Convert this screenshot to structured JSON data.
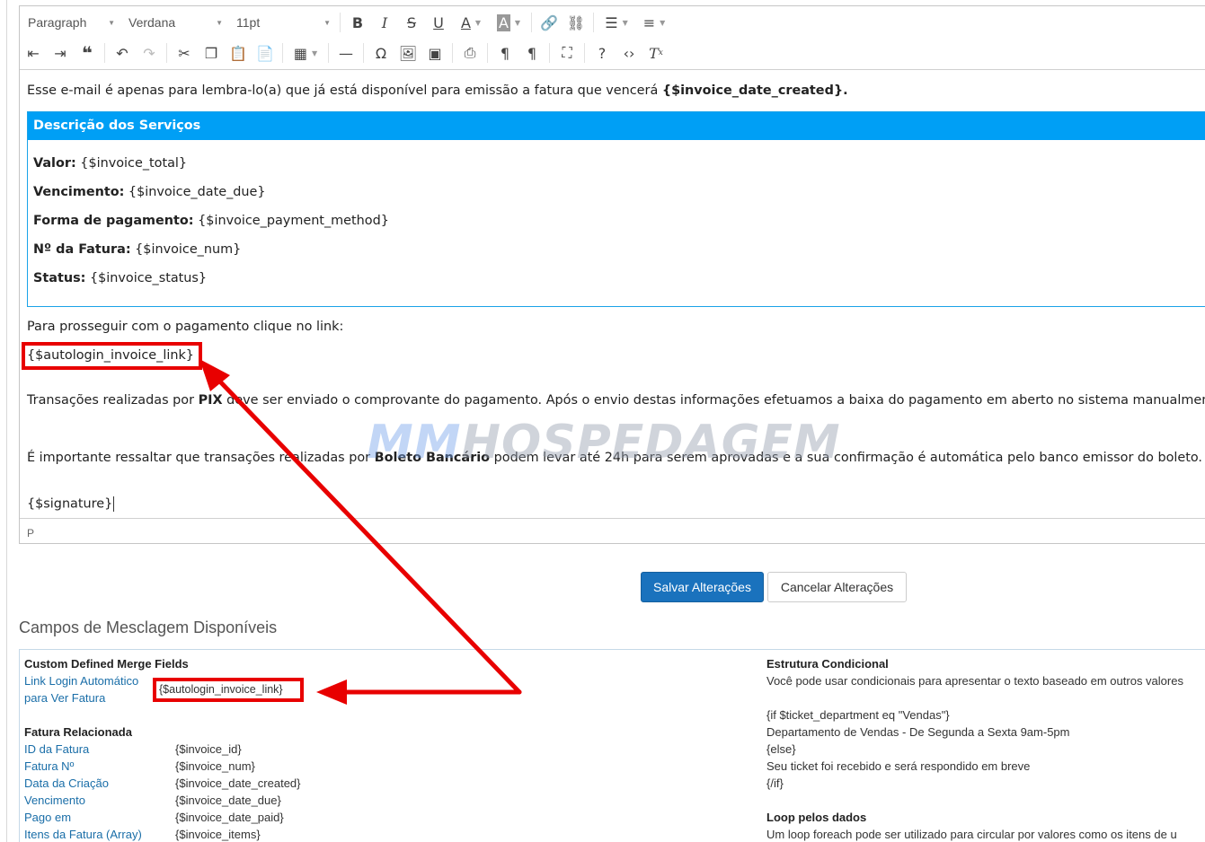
{
  "toolbar": {
    "format": "Paragraph",
    "font": "Verdana",
    "size": "11pt",
    "row1_icons": [
      "bold-icon",
      "italic-icon",
      "strikethrough-icon",
      "underline-icon",
      "font-color-icon",
      "background-color-icon",
      "link-icon",
      "unlink-icon",
      "bullet-list-icon",
      "numbered-list-icon"
    ],
    "row2_icons": [
      "outdent-icon",
      "indent-icon",
      "blockquote-icon",
      "undo-icon",
      "redo-icon",
      "cut-icon",
      "copy-icon",
      "paste-icon",
      "paste-text-icon",
      "table-icon",
      "horizontal-rule-icon",
      "special-char-icon",
      "image-icon",
      "media-icon",
      "print-icon",
      "ltr-icon",
      "rtl-icon",
      "fullscreen-icon",
      "help-icon",
      "source-code-icon",
      "clear-format-icon"
    ]
  },
  "content": {
    "intro_text": "Esse e-mail é apenas para lembra-lo(a) que já está disponível para emissão a fatura que vencerá ",
    "intro_var": "{$invoice_date_created}.",
    "services": {
      "heading": "Descrição dos Serviços",
      "lines": [
        {
          "label": "Valor:",
          "value": " {$invoice_total}"
        },
        {
          "label": "Vencimento:",
          "value": " {$invoice_date_due}"
        },
        {
          "label": "Forma de pagamento:",
          "value": " {$invoice_payment_method}"
        },
        {
          "label": "Nº da Fatura:",
          "value": " {$invoice_num}"
        },
        {
          "label": "Status:",
          "value": " {$invoice_status}"
        }
      ]
    },
    "payment_text": "Para prosseguir com o pagamento clique no link:",
    "autologin_var": "{$autologin_invoice_link}",
    "pix_text_1": "Transações realizadas por ",
    "pix_bold": "PIX",
    "pix_text_2": " deve ser enviado o comprovante do pagamento. Após o envio destas informações efetuamos a baixa do pagamento em aberto no sistema manualmente.",
    "boleto_text_1": "É importante ressaltar que transações realizadas por ",
    "boleto_bold": "Boleto Bancário",
    "boleto_text_2": " podem levar até 24h para serem aprovadas e a sua confirmação é automática pelo banco emissor do boleto.",
    "signature": "{$signature}"
  },
  "statusbar": {
    "path": "P"
  },
  "watermark": {
    "part1": "MM",
    "part2": "HOSPEDAGEM"
  },
  "buttons": {
    "save": "Salvar Alterações",
    "cancel": "Cancelar Alterações"
  },
  "merge": {
    "title": "Campos de Mesclagem Disponíveis",
    "custom_heading": "Custom Defined Merge Fields",
    "autologin_label_1": "Link Login Automático",
    "autologin_label_2": "para Ver Fatura",
    "autologin_code": "{$autologin_invoice_link}",
    "invoice_heading": "Fatura Relacionada",
    "invoice_fields": [
      {
        "label": "ID da Fatura",
        "code": "{$invoice_id}"
      },
      {
        "label": "Fatura Nº",
        "code": "{$invoice_num}"
      },
      {
        "label": "Data da Criação",
        "code": "{$invoice_date_created}"
      },
      {
        "label": "Vencimento",
        "code": "{$invoice_date_due}"
      },
      {
        "label": "Pago em",
        "code": "{$invoice_date_paid}"
      },
      {
        "label": "Itens da Fatura (Array)",
        "code": "{$invoice_items}"
      }
    ],
    "conditional_heading": "Estrutura Condicional",
    "conditional_desc": "Você pode usar condicionais para apresentar o texto baseado em outros valores",
    "cond_lines": [
      "{if $ticket_department eq \"Vendas\"}",
      "Departamento de Vendas - De Segunda a Sexta 9am-5pm",
      "{else}",
      "Seu ticket foi recebido e será respondido em breve",
      "{/if}"
    ],
    "loop_heading": "Loop pelos dados",
    "loop_desc": "Um loop foreach pode ser utilizado para circular por valores como os itens de u"
  },
  "annotation_color": "#e80000"
}
